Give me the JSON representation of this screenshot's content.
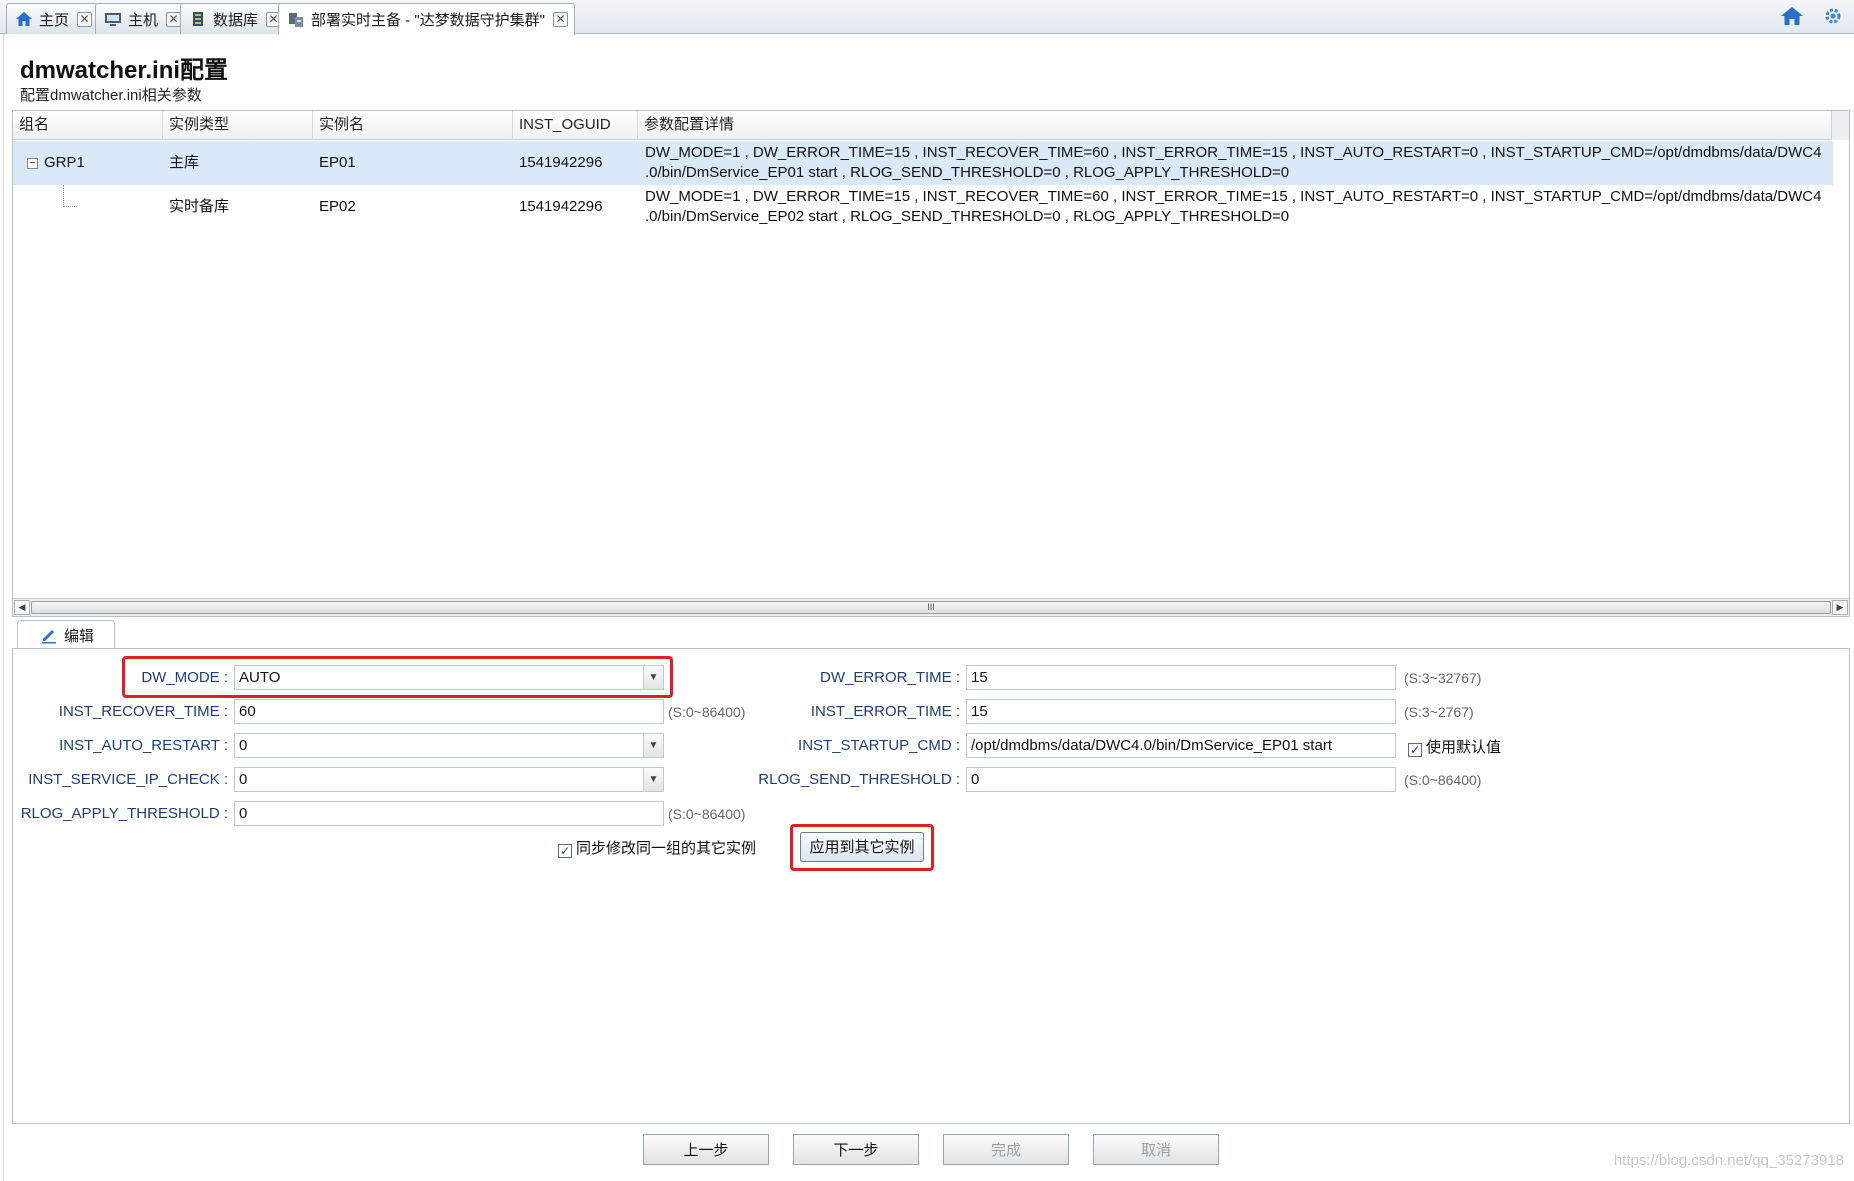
{
  "tabs": [
    {
      "label": "主页",
      "icon": "home-icon",
      "active": false
    },
    {
      "label": "主机",
      "icon": "host-icon",
      "active": false
    },
    {
      "label": "数据库",
      "icon": "database-icon",
      "active": false
    },
    {
      "label": "部署实时主备 - \"达梦数据守护集群\"",
      "icon": "deploy-icon",
      "active": true
    }
  ],
  "tab_close": "✕",
  "header": {
    "title": "dmwatcher.ini配置",
    "subtitle": "配置dmwatcher.ini相关参数"
  },
  "grid": {
    "columns": [
      "组名",
      "实例类型",
      "实例名",
      "INST_OGUID",
      "参数配置详情"
    ],
    "rows": [
      {
        "group": "GRP1",
        "type": "主库",
        "name": "EP01",
        "oguid": "1541942296",
        "detail_line1": "DW_MODE=1 , DW_ERROR_TIME=15 , INST_RECOVER_TIME=60 , INST_ERROR_TIME=15 , INST_AUTO_RESTART=0 , INST_STARTUP_CMD=/opt/dmdbms/data/DWC4",
        "detail_line2": ".0/bin/DmService_EP01 start , RLOG_SEND_THRESHOLD=0 , RLOG_APPLY_THRESHOLD=0"
      },
      {
        "group": "",
        "type": "实时备库",
        "name": "EP02",
        "oguid": "1541942296",
        "detail_line1": "DW_MODE=1 , DW_ERROR_TIME=15 , INST_RECOVER_TIME=60 , INST_ERROR_TIME=15 , INST_AUTO_RESTART=0 , INST_STARTUP_CMD=/opt/dmdbms/data/DWC4",
        "detail_line2": ".0/bin/DmService_EP02 start , RLOG_SEND_THRESHOLD=0 , RLOG_APPLY_THRESHOLD=0"
      }
    ],
    "scroll_thumb_grip": "III"
  },
  "edit": {
    "tab_label": "编辑",
    "fields": {
      "dw_mode": {
        "label": "DW_MODE :",
        "value": "AUTO"
      },
      "inst_recover_time": {
        "label": "INST_RECOVER_TIME :",
        "value": "60",
        "range": "(S:0~86400)"
      },
      "inst_auto_restart": {
        "label": "INST_AUTO_RESTART :",
        "value": "0"
      },
      "inst_service_ip_check": {
        "label": "INST_SERVICE_IP_CHECK :",
        "value": "0"
      },
      "rlog_apply_threshold": {
        "label": "RLOG_APPLY_THRESHOLD :",
        "value": "0",
        "range": "(S:0~86400)"
      },
      "dw_error_time": {
        "label": "DW_ERROR_TIME :",
        "value": "15",
        "range": "(S:3~32767)"
      },
      "inst_error_time": {
        "label": "INST_ERROR_TIME :",
        "value": "15",
        "range": "(S:3~2767)"
      },
      "inst_startup_cmd": {
        "label": "INST_STARTUP_CMD :",
        "value": "/opt/dmdbms/data/DWC4.0/bin/DmService_EP01 start",
        "use_default_label": "使用默认值",
        "use_default_checked": true
      },
      "rlog_send_threshold": {
        "label": "RLOG_SEND_THRESHOLD :",
        "value": "0",
        "range": "(S:0~86400)"
      }
    },
    "sync_label": "同步修改同一组的其它实例",
    "sync_checked": true,
    "apply_button": "应用到其它实例",
    "check_mark": "✓",
    "dropdown_arrow": "▼"
  },
  "wizard": {
    "prev": "上一步",
    "next": "下一步",
    "finish": "完成",
    "cancel": "取消"
  },
  "watermark": "https://blog.csdn.net/qq_35273918",
  "colors": {
    "highlight": "#e02020",
    "selected_row": "#d9e9f8",
    "label_blue": "#1f3f73"
  }
}
